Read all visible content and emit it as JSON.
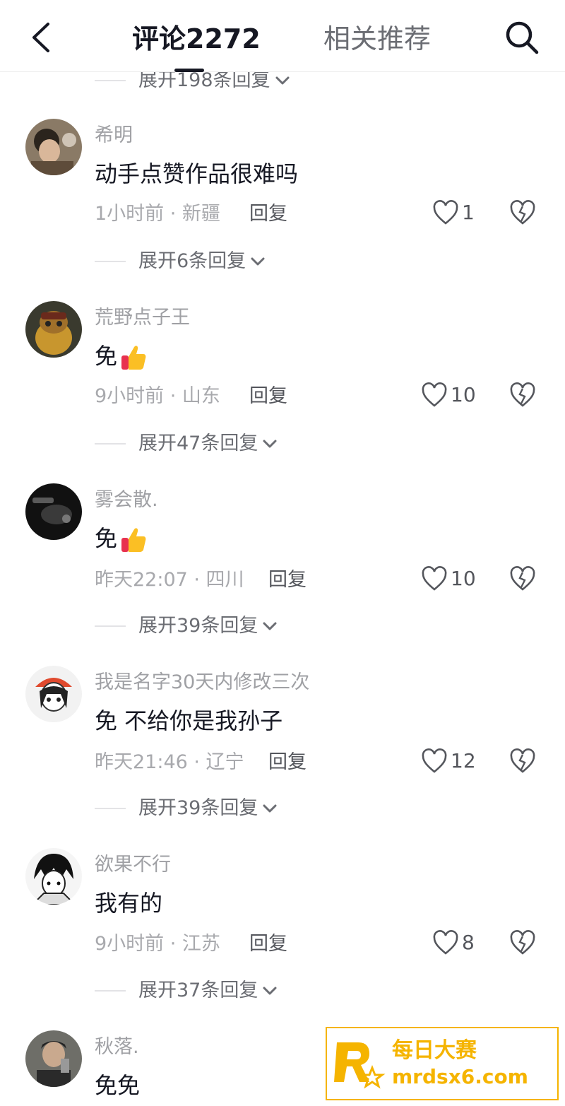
{
  "header": {
    "tab_comments": "评论2272",
    "tab_related": "相关推荐"
  },
  "top_expand": "展开198条回复",
  "comments": [
    {
      "username": "希明",
      "text": "动手点赞作品很难吗",
      "meta": "1小时前 · 新疆",
      "reply": "回复",
      "likes": "1",
      "expand": "展开6条回复"
    },
    {
      "username": "荒野点子王",
      "text": "免",
      "emoji": "thumbs-up",
      "meta": "9小时前 · 山东",
      "reply": "回复",
      "likes": "10",
      "expand": "展开47条回复"
    },
    {
      "username": "雾会散.",
      "text": "免",
      "emoji": "thumbs-up",
      "meta": "昨天22:07 · 四川",
      "reply": "回复",
      "likes": "10",
      "expand": "展开39条回复"
    },
    {
      "username": "我是名字30天内修改三次",
      "text": "免 不给你是我孙子",
      "meta": "昨天21:46 · 辽宁",
      "reply": "回复",
      "likes": "12",
      "expand": "展开39条回复"
    },
    {
      "username": "欲果不行",
      "text": "我有的",
      "meta": "9小时前 · 江苏",
      "reply": "回复",
      "likes": "8",
      "expand": "展开37条回复"
    },
    {
      "username": "秋落.",
      "text": "免免"
    }
  ],
  "watermark": {
    "name": "每日大赛",
    "url": "mrdsx6.com"
  },
  "colors": {
    "primary_text": "#161823",
    "secondary_text": "#9fa0a4",
    "accent_watermark": "#f5b400"
  }
}
